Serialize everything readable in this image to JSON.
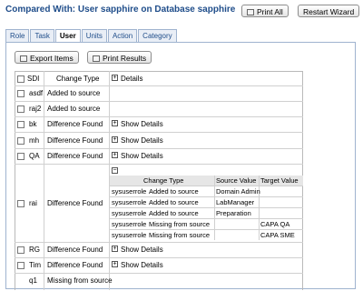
{
  "header": {
    "title": "Compared With: User sapphire on Database sapphire",
    "print_all": "Print All",
    "restart_wizard": "Restart Wizard"
  },
  "tabs": [
    {
      "label": "Role",
      "active": false
    },
    {
      "label": "Task",
      "active": false
    },
    {
      "label": "User",
      "active": true
    },
    {
      "label": "Units",
      "active": false
    },
    {
      "label": "Action",
      "active": false
    },
    {
      "label": "Category",
      "active": false
    }
  ],
  "toolbar": {
    "export": "Export Items",
    "print_results": "Print Results"
  },
  "table": {
    "col_sdi": "SDI",
    "col_change_type": "Change Type",
    "col_details": "Details",
    "show_details": "Show Details",
    "rows": [
      {
        "sdi": "asdf",
        "change": "Added to source"
      },
      {
        "sdi": "raj2",
        "change": "Added to source"
      },
      {
        "sdi": "bk",
        "change": "Difference Found"
      },
      {
        "sdi": "mh",
        "change": "Difference Found"
      },
      {
        "sdi": "QA",
        "change": "Difference Found"
      },
      {
        "sdi": "rai",
        "change": "Difference Found"
      },
      {
        "sdi": "RG",
        "change": "Difference Found"
      },
      {
        "sdi": "Tim",
        "change": "Difference Found"
      },
      {
        "sdi": "q1",
        "change": "Missing from source"
      }
    ],
    "subtable": {
      "headers": [
        "Change Type",
        "Source Value",
        "Target Value"
      ],
      "rows": [
        {
          "name": "sysuserrole",
          "change": "Added to source",
          "source": "Domain Admin",
          "target": ""
        },
        {
          "name": "sysuserrole",
          "change": "Added to source",
          "source": "LabManager",
          "target": ""
        },
        {
          "name": "sysuserrole",
          "change": "Added to source",
          "source": "Preparation",
          "target": ""
        },
        {
          "name": "sysuserrole",
          "change": "Missing from source",
          "source": "",
          "target": "CAPA QA"
        },
        {
          "name": "sysuserrole",
          "change": "Missing from source",
          "source": "",
          "target": "CAPA SME"
        }
      ]
    }
  }
}
